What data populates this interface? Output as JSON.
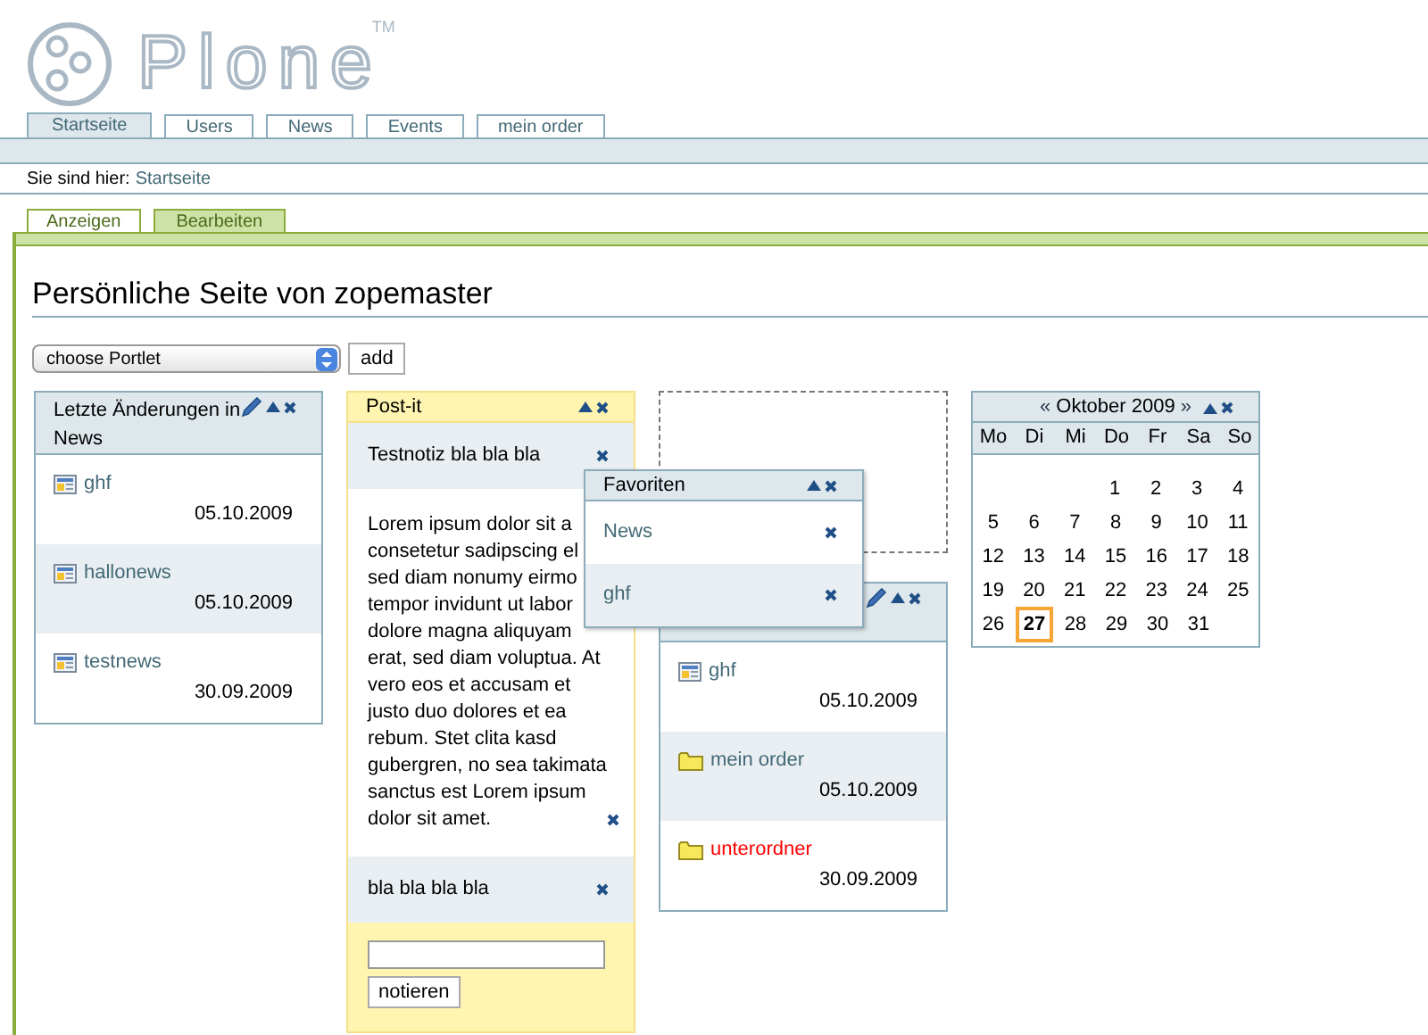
{
  "logo": {
    "name": "Plone",
    "trademark": "TM"
  },
  "nav_tabs": [
    {
      "label": "Startseite",
      "selected": true
    },
    {
      "label": "Users",
      "selected": false
    },
    {
      "label": "News",
      "selected": false
    },
    {
      "label": "Events",
      "selected": false
    },
    {
      "label": "mein order",
      "selected": false
    }
  ],
  "breadcrumb": {
    "label": "Sie sind hier:",
    "path": "Startseite"
  },
  "view_tabs": [
    {
      "label": "Anzeigen",
      "selected": false
    },
    {
      "label": "Bearbeiten",
      "selected": true
    }
  ],
  "heading": "Persönliche Seite von zopemaster",
  "portlet_picker": {
    "value": "choose Portlet",
    "button": "add"
  },
  "columns": [
    {
      "portlets": [
        {
          "kind": "list",
          "title": "Letzte Änderungen in News",
          "editable": true,
          "items": [
            {
              "kind": "news",
              "label": "ghf",
              "date": "05.10.2009",
              "color": "#436976"
            },
            {
              "kind": "news",
              "label": "hallonews",
              "date": "05.10.2009",
              "color": "#436976"
            },
            {
              "kind": "news",
              "label": "testnews",
              "date": "30.09.2009",
              "color": "#436976"
            }
          ]
        }
      ]
    },
    {
      "portlets": [
        {
          "kind": "postit",
          "title": "Post-it",
          "notes": [
            {
              "lines": [
                "Testnotiz bla bla bla"
              ]
            },
            {
              "lines": [
                "Lorem ipsum dolor sit a",
                "consetetur sadipscing el",
                "sed diam nonumy eirmo",
                "tempor invidunt ut labor",
                "dolore magna aliquyam",
                "erat, sed diam voluptua. At",
                "vero eos et accusam et",
                "justo duo dolores et ea",
                "rebum. Stet clita kasd",
                "gubergren, no sea takimata",
                "sanctus est Lorem ipsum",
                "dolor sit amet."
              ]
            },
            {
              "lines": [
                "bla bla bla bla"
              ]
            }
          ],
          "button": "notieren"
        }
      ]
    },
    {
      "portlets": [
        {
          "kind": "placeholder"
        },
        {
          "kind": "list",
          "editable": true,
          "items": [
            {
              "kind": "news",
              "label": "ghf",
              "date": "05.10.2009",
              "color": "#436976"
            },
            {
              "kind": "folder",
              "label": "mein order",
              "date": "05.10.2009",
              "color": "#436976"
            },
            {
              "kind": "folder",
              "label": "unterordner",
              "date": "30.09.2009",
              "color": "#ff0000"
            }
          ]
        }
      ]
    },
    {
      "portlets": [
        {
          "kind": "calendar",
          "prev": "«",
          "month": "Oktober 2009",
          "next": "»",
          "weekdays": [
            "Mo",
            "Di",
            "Mi",
            "Do",
            "Fr",
            "Sa",
            "So"
          ],
          "weeks": [
            {
              "kind": "end_aligned",
              "days": [
                {
                  "day": "1",
                  "today": false
                },
                {
                  "day": "2",
                  "today": false
                },
                {
                  "day": "3",
                  "today": false
                },
                {
                  "day": "4",
                  "today": false
                }
              ]
            },
            {
              "kind": "start_aligned",
              "days": [
                {
                  "day": "5",
                  "today": false
                },
                {
                  "day": "6",
                  "today": false
                },
                {
                  "day": "7",
                  "today": false
                },
                {
                  "day": "8",
                  "today": false
                },
                {
                  "day": "9",
                  "today": false
                },
                {
                  "day": "10",
                  "today": false
                },
                {
                  "day": "11",
                  "today": false
                }
              ]
            },
            {
              "kind": "start_aligned",
              "days": [
                {
                  "day": "12",
                  "today": false
                },
                {
                  "day": "13",
                  "today": false
                },
                {
                  "day": "14",
                  "today": false
                },
                {
                  "day": "15",
                  "today": false
                },
                {
                  "day": "16",
                  "today": false
                },
                {
                  "day": "17",
                  "today": false
                },
                {
                  "day": "18",
                  "today": false
                }
              ]
            },
            {
              "kind": "start_aligned",
              "days": [
                {
                  "day": "19",
                  "today": false
                },
                {
                  "day": "20",
                  "today": false
                },
                {
                  "day": "21",
                  "today": false
                },
                {
                  "day": "22",
                  "today": false
                },
                {
                  "day": "23",
                  "today": false
                },
                {
                  "day": "24",
                  "today": false
                },
                {
                  "day": "25",
                  "today": false
                }
              ]
            },
            {
              "kind": "start_aligned",
              "days": [
                {
                  "day": "26",
                  "today": false
                },
                {
                  "day": "27",
                  "today": true
                },
                {
                  "day": "28",
                  "today": false
                },
                {
                  "day": "29",
                  "today": false
                },
                {
                  "day": "30",
                  "today": false
                },
                {
                  "day": "31",
                  "today": false
                }
              ]
            }
          ]
        }
      ]
    }
  ],
  "dragged_portlet": {
    "title": "Favoriten",
    "items": [
      {
        "label": "News"
      },
      {
        "label": "ghf"
      }
    ]
  }
}
